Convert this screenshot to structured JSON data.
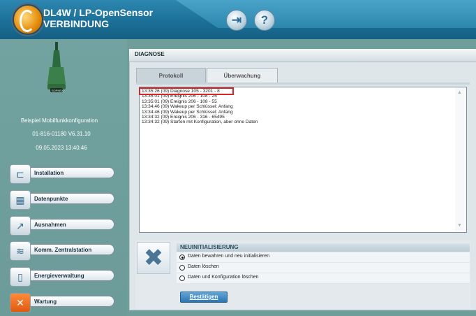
{
  "header": {
    "title_line1": "DL4W / LP-OpenSensor",
    "title_line2": "VERBINDUNG",
    "buttons": [
      {
        "icon": "door-exit-icon",
        "glyph": "⇥"
      },
      {
        "icon": "help-icon",
        "glyph": "?"
      }
    ]
  },
  "sidebar": {
    "config_name": "Beispiel Mobilfunkkonfiguration",
    "device_id_version": "01-816-01180    V6.31.10",
    "datetime": "09.05.2023 13:40:46",
    "device_label": "SOPHEX",
    "nav": [
      {
        "label": "Installation",
        "icon": "plug-icon",
        "glyph": "⊏"
      },
      {
        "label": "Datenpunkte",
        "icon": "table-icon",
        "glyph": "▦"
      },
      {
        "label": "Ausnahmen",
        "icon": "chart-icon",
        "glyph": "↗"
      },
      {
        "label": "Komm. Zentralstation",
        "icon": "wifi-icon",
        "glyph": "≋"
      },
      {
        "label": "Energieverwaltung",
        "icon": "battery-icon",
        "glyph": "▯"
      },
      {
        "label": "Wartung",
        "icon": "tools-icon",
        "glyph": "✕"
      }
    ]
  },
  "panel": {
    "title": "DIAGNOSE",
    "tabs": [
      "Protokoll",
      "Überwachung"
    ],
    "log": [
      "13:35:26 (09)  Diagnose 105 - 3201 - 8",
      "13:35:01 (09)  Ereignis 206 - 108 - 25",
      "13:35:01 (09)  Ereignis 206 - 108 - 55",
      "13:34:46 (09)  Wakeup per Schlüssel: Anfang",
      "13:34:46 (09)  Wakeup per Schlüssel: Anfang",
      "13:34:32 (09)  Ereignis 206 - 316 - 65495",
      "13:34:32 (09)  Starten mit Konfiguration, aber ohne Daten"
    ]
  },
  "reinit": {
    "title": "NEUINITIALISIERUNG",
    "options": [
      "Daten bewahren und neu initialisieren",
      "Daten löschen",
      "Daten und Konfiguration löschen"
    ],
    "selected_index": 0,
    "confirm_label": "Bestätigen"
  },
  "colors": {
    "header": "#1a6e96",
    "sidebar": "#6f9e9a",
    "highlight": "#d7262a"
  }
}
